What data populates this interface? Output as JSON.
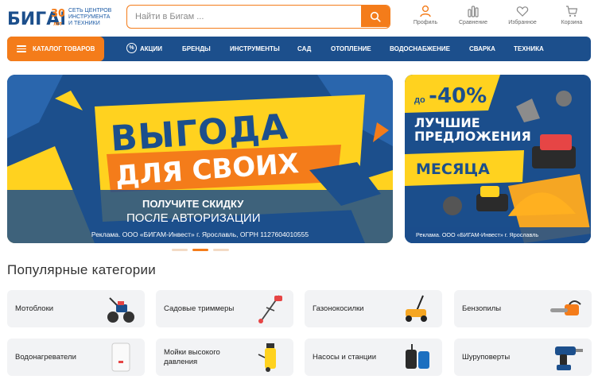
{
  "header": {
    "logo_text": "БИГАМ",
    "logo_badge": "30 ЛЕТ",
    "tagline": [
      "Сеть центров",
      "инструмента",
      "и техники"
    ],
    "search_placeholder": "Найти в Бигам ...",
    "actions": [
      {
        "label": "Профиль",
        "icon": "user-icon"
      },
      {
        "label": "Сравнение",
        "icon": "compare-icon"
      },
      {
        "label": "Избранное",
        "icon": "heart-icon"
      },
      {
        "label": "Корзина",
        "icon": "cart-icon"
      }
    ]
  },
  "nav": {
    "catalog_label": "Каталог товаров",
    "items": [
      "Акции",
      "Бренды",
      "Инструменты",
      "Сад",
      "Отопление",
      "Водоснабжение",
      "Сварка",
      "Техника"
    ],
    "promo_icon": "%"
  },
  "banners": [
    {
      "title1": "ВЫГОДА",
      "title2": "ДЛЯ СВОИХ",
      "subtitle1": "ПОЛУЧИТЕ СКИДКУ",
      "subtitle2": "ПОСЛЕ АВТОРИЗАЦИИ",
      "ad_text": "Реклама. ООО «БИГАМ-Инвест» г. Ярославль, ОГРН 1127604010555"
    },
    {
      "prefix": "до",
      "percent": "-40%",
      "line1": "ЛУЧШИЕ",
      "line2": "ПРЕДЛОЖЕНИЯ",
      "line3": "МЕСЯЦА",
      "ad_text": "Реклама. ООО «БИГАМ-Инвест» г. Ярославль"
    }
  ],
  "carousel": {
    "count": 3,
    "active": 1
  },
  "popular": {
    "title": "Популярные категории",
    "items": [
      {
        "label": "Мотоблоки",
        "icon": "tiller-icon"
      },
      {
        "label": "Садовые триммеры",
        "icon": "trimmer-icon"
      },
      {
        "label": "Газонокосилки",
        "icon": "lawnmower-icon"
      },
      {
        "label": "Бензопилы",
        "icon": "chainsaw-icon"
      },
      {
        "label": "Водонагреватели",
        "icon": "water-heater-icon"
      },
      {
        "label": "Мойки высокого давления",
        "icon": "pressure-washer-icon"
      },
      {
        "label": "Насосы и станции",
        "icon": "pump-icon"
      },
      {
        "label": "Шуруповерты",
        "icon": "drill-icon"
      }
    ]
  },
  "colors": {
    "brand_blue": "#1c4f8c",
    "accent_orange": "#f47c1a",
    "yellow": "#ffd21f"
  }
}
